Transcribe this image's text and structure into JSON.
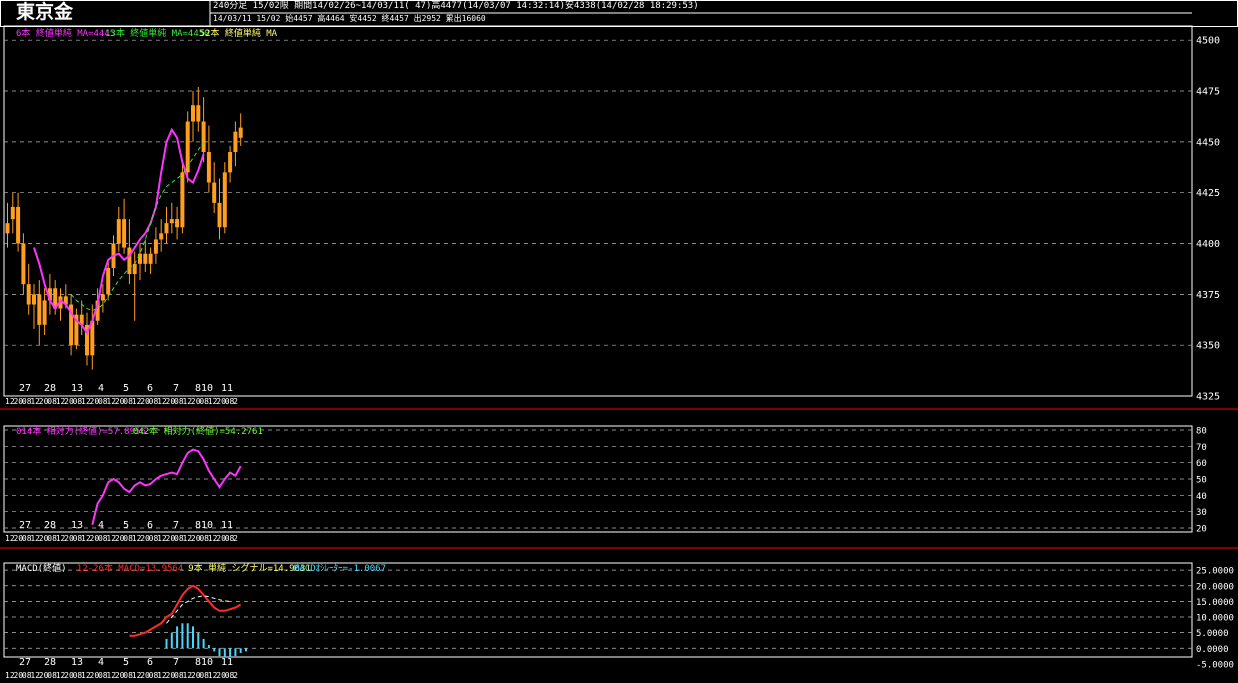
{
  "header": {
    "title": "東京金",
    "line1": "240分足 15/02限  期間14/02/26~14/03/11( 47)高4477(14/03/07 14:32:14)安4338(14/02/28 18:29:53)",
    "line2": "14/03/11 15/02 始4457 高4464 安4452 終4457 出2952 累出16060"
  },
  "colors": {
    "background": "#000000",
    "frame": "#ffffff",
    "separator": "#cc0000",
    "candle": "#ff9e1f",
    "ma6": "#ff33ff",
    "ma13": "#33ee33",
    "ma52": "#ffff66",
    "rsi14": "#ff33ff",
    "rsi42": "#66ff33",
    "macd": "#ff2a2a",
    "signal": "#ffff66",
    "histogram": "#44d8ff"
  },
  "x_axis": {
    "day_labels": [
      "27",
      "28",
      "13",
      "4",
      "5",
      "6",
      "7",
      "810",
      "11"
    ],
    "time_labels": [
      "12",
      "20",
      "08",
      "12",
      "20",
      "08",
      "12",
      "20",
      "08",
      "12",
      "20",
      "08",
      "12",
      "20",
      "08",
      "12",
      "20",
      "08",
      "12",
      "20",
      "08",
      "12",
      "20",
      "08",
      "12",
      "20",
      "08",
      "2"
    ]
  },
  "chart_data": [
    {
      "type": "candlestick",
      "legend": [
        "6本 終値単純 MA=4445",
        "13本 終値単純 MA=4450",
        "52本 終値単純 MA"
      ],
      "yticks": [
        4325,
        4350,
        4375,
        4400,
        4425,
        4450,
        4475,
        4500
      ],
      "ylim": [
        4325,
        4506
      ],
      "grid": true,
      "candles": [
        {
          "o": 4405,
          "h": 4420,
          "l": 4398,
          "c": 4410
        },
        {
          "o": 4412,
          "h": 4425,
          "l": 4405,
          "c": 4418
        },
        {
          "o": 4418,
          "h": 4425,
          "l": 4396,
          "c": 4400
        },
        {
          "o": 4400,
          "h": 4405,
          "l": 4375,
          "c": 4380
        },
        {
          "o": 4380,
          "h": 4390,
          "l": 4365,
          "c": 4370
        },
        {
          "o": 4370,
          "h": 4380,
          "l": 4358,
          "c": 4375
        },
        {
          "o": 4375,
          "h": 4382,
          "l": 4350,
          "c": 4360
        },
        {
          "o": 4360,
          "h": 4378,
          "l": 4355,
          "c": 4372
        },
        {
          "o": 4372,
          "h": 4385,
          "l": 4365,
          "c": 4378
        },
        {
          "o": 4378,
          "h": 4382,
          "l": 4365,
          "c": 4368
        },
        {
          "o": 4368,
          "h": 4378,
          "l": 4362,
          "c": 4374
        },
        {
          "o": 4374,
          "h": 4380,
          "l": 4368,
          "c": 4370
        },
        {
          "o": 4370,
          "h": 4375,
          "l": 4345,
          "c": 4350
        },
        {
          "o": 4350,
          "h": 4368,
          "l": 4348,
          "c": 4365
        },
        {
          "o": 4365,
          "h": 4372,
          "l": 4355,
          "c": 4360
        },
        {
          "o": 4360,
          "h": 4366,
          "l": 4340,
          "c": 4345
        },
        {
          "o": 4345,
          "h": 4370,
          "l": 4338,
          "c": 4362
        },
        {
          "o": 4362,
          "h": 4378,
          "l": 4360,
          "c": 4372
        },
        {
          "o": 4372,
          "h": 4380,
          "l": 4366,
          "c": 4375
        },
        {
          "o": 4375,
          "h": 4392,
          "l": 4372,
          "c": 4388
        },
        {
          "o": 4388,
          "h": 4404,
          "l": 4384,
          "c": 4400
        },
        {
          "o": 4400,
          "h": 4418,
          "l": 4396,
          "c": 4412
        },
        {
          "o": 4412,
          "h": 4422,
          "l": 4395,
          "c": 4398
        },
        {
          "o": 4398,
          "h": 4412,
          "l": 4380,
          "c": 4385
        },
        {
          "o": 4385,
          "h": 4396,
          "l": 4362,
          "c": 4390
        },
        {
          "o": 4390,
          "h": 4400,
          "l": 4382,
          "c": 4395
        },
        {
          "o": 4395,
          "h": 4402,
          "l": 4386,
          "c": 4390
        },
        {
          "o": 4390,
          "h": 4398,
          "l": 4385,
          "c": 4395
        },
        {
          "o": 4395,
          "h": 4408,
          "l": 4390,
          "c": 4402
        },
        {
          "o": 4402,
          "h": 4412,
          "l": 4396,
          "c": 4405
        },
        {
          "o": 4405,
          "h": 4418,
          "l": 4400,
          "c": 4410
        },
        {
          "o": 4410,
          "h": 4420,
          "l": 4405,
          "c": 4412
        },
        {
          "o": 4412,
          "h": 4418,
          "l": 4402,
          "c": 4408
        },
        {
          "o": 4408,
          "h": 4440,
          "l": 4405,
          "c": 4435
        },
        {
          "o": 4435,
          "h": 4465,
          "l": 4430,
          "c": 4460
        },
        {
          "o": 4460,
          "h": 4475,
          "l": 4450,
          "c": 4468
        },
        {
          "o": 4468,
          "h": 4477,
          "l": 4455,
          "c": 4460
        },
        {
          "o": 4460,
          "h": 4472,
          "l": 4440,
          "c": 4445
        },
        {
          "o": 4445,
          "h": 4458,
          "l": 4425,
          "c": 4430
        },
        {
          "o": 4430,
          "h": 4440,
          "l": 4415,
          "c": 4420
        },
        {
          "o": 4420,
          "h": 4432,
          "l": 4402,
          "c": 4408
        },
        {
          "o": 4408,
          "h": 4440,
          "l": 4405,
          "c": 4435
        },
        {
          "o": 4435,
          "h": 4448,
          "l": 4430,
          "c": 4445
        },
        {
          "o": 4445,
          "h": 4460,
          "l": 4438,
          "c": 4455
        },
        {
          "o": 4452,
          "h": 4464,
          "l": 4448,
          "c": 4457
        }
      ],
      "series": [
        {
          "name": "6本 終値単純 MA",
          "start": 5,
          "values": [
            4398,
            4390,
            4380,
            4372,
            4368,
            4372,
            4370,
            4366,
            4362,
            4360,
            4356,
            4362,
            4370,
            4384,
            4392,
            4394,
            4395,
            4392,
            4394,
            4398,
            4402,
            4405,
            4410,
            4418,
            4435,
            4450,
            4456,
            4452,
            4440,
            4432,
            4430,
            4436,
            4444
          ]
        },
        {
          "name": "13本 終値単純 MA",
          "start": 12,
          "values": [
            4375,
            4372,
            4370,
            4368,
            4367,
            4368,
            4370,
            4374,
            4378,
            4382,
            4385,
            4388,
            4390,
            4395,
            4402,
            4410,
            4418,
            4424,
            4428,
            4430,
            4432,
            4434,
            4438,
            4442,
            4446,
            4450
          ]
        }
      ]
    },
    {
      "type": "line",
      "legend": [
        "014本 相対力(終値)=57.8956",
        "042本 相対力(終値)=54.2761"
      ],
      "yticks": [
        20,
        30,
        40,
        50,
        60,
        70,
        80
      ],
      "ylim": [
        20,
        80
      ],
      "grid": true,
      "series": [
        {
          "name": "014本 相対力(終値)",
          "start": 16,
          "values": [
            22,
            35,
            40,
            48,
            50,
            48,
            44,
            42,
            46,
            48,
            46,
            47,
            50,
            52,
            53,
            54,
            53,
            60,
            66,
            68,
            67,
            62,
            55,
            50,
            45,
            50,
            54,
            52,
            57.9
          ]
        },
        {
          "name": "042本 相対力(終値)",
          "start": 42,
          "values": [
            54.3
          ]
        }
      ]
    },
    {
      "type": "line",
      "legend": [
        "MACD(終値)",
        "12-26本 MACD=13.9564",
        "9本 単純 シグナル=14.9631",
        "MACDｵｼﾚｰﾀｰ=-1.0067"
      ],
      "yticks": [
        -5,
        0,
        5,
        10,
        15,
        20,
        25
      ],
      "ytick_labels": [
        "-5.0000",
        "0.0000",
        "5.0000",
        "10.0000",
        "15.0000",
        "20.0000",
        "25.0000"
      ],
      "ylim": [
        -6,
        26
      ],
      "grid": true,
      "series": [
        {
          "name": "MACD",
          "start": 23,
          "values": [
            4,
            4,
            4.5,
            5,
            6,
            7,
            8,
            10,
            11,
            14,
            17,
            19,
            20,
            19,
            17,
            15,
            13,
            12,
            12,
            12.5,
            13,
            14
          ]
        },
        {
          "name": "シグナル",
          "start": 30,
          "values": [
            8,
            10,
            12,
            14,
            15,
            16,
            16.5,
            16.8,
            16.5,
            16,
            15.5,
            15.2,
            14.96
          ]
        },
        {
          "name": "MACDｵｼﾚｰﾀｰ",
          "start": 30,
          "values": [
            3,
            5,
            7,
            8,
            8,
            7,
            5,
            3,
            1,
            -1,
            -2.5,
            -3,
            -3,
            -2.5,
            -1.5,
            -1
          ]
        }
      ]
    }
  ]
}
